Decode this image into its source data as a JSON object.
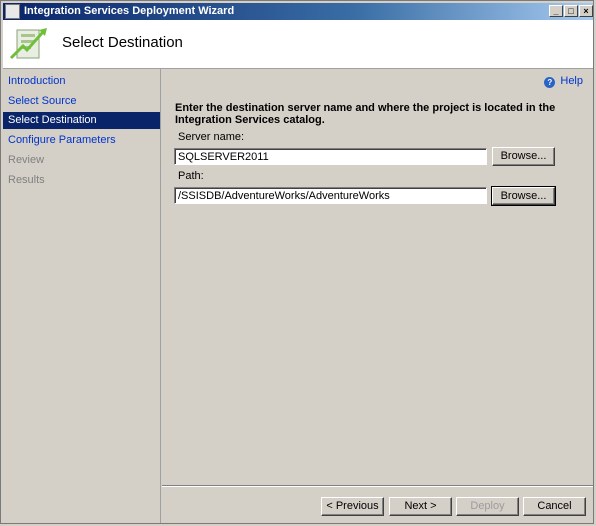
{
  "window": {
    "title": "Integration Services Deployment Wizard"
  },
  "header": {
    "heading": "Select Destination"
  },
  "nav": {
    "items": [
      {
        "label": "Introduction",
        "state": "link"
      },
      {
        "label": "Select Source",
        "state": "link"
      },
      {
        "label": "Select Destination",
        "state": "active"
      },
      {
        "label": "Configure Parameters",
        "state": "link"
      },
      {
        "label": "Review",
        "state": "disabled"
      },
      {
        "label": "Results",
        "state": "disabled"
      }
    ]
  },
  "main": {
    "help_label": "Help",
    "instruction": "Enter the destination server name and where the project is located in the Integration Services catalog.",
    "server": {
      "label": "Server name:",
      "value": "SQLSERVER2011",
      "browse_label": "Browse..."
    },
    "path": {
      "label": "Path:",
      "value": "/SSISDB/AdventureWorks/AdventureWorks",
      "browse_label": "Browse..."
    }
  },
  "footer": {
    "previous_label": "< Previous",
    "next_label": "Next >",
    "deploy_label": "Deploy",
    "cancel_label": "Cancel"
  },
  "colors": {
    "title_bar": "#0a246a",
    "nav_active": "#0a246a",
    "link": "#0033cc",
    "face": "#d4d0c8"
  }
}
